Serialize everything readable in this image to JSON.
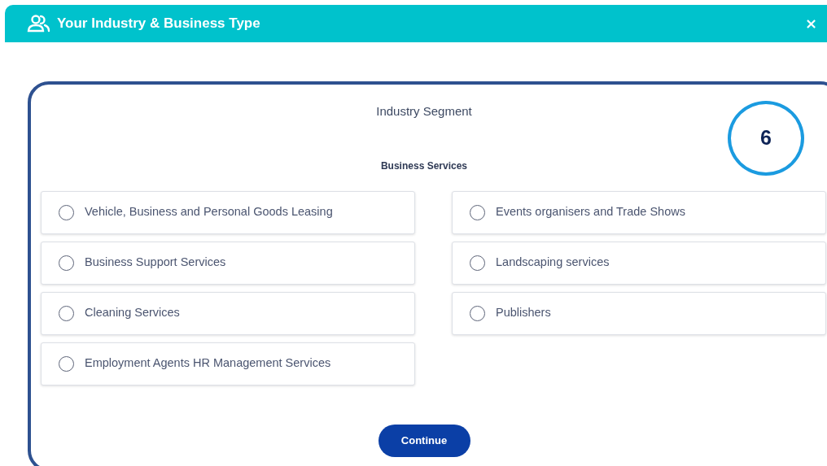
{
  "window": {
    "title": "Your Industry & Business Type",
    "close": "×"
  },
  "section": {
    "title": "Industry Segment",
    "callout": "6",
    "subtitle": "Business Services"
  },
  "options": [
    {
      "label": "Vehicle, Business and Personal Goods Leasing",
      "selected": false
    },
    {
      "label": "Events organisers and Trade Shows",
      "selected": false
    },
    {
      "label": "Business Support Services",
      "selected": false
    },
    {
      "label": "Landscaping services",
      "selected": false
    },
    {
      "label": "Cleaning Services",
      "selected": false
    },
    {
      "label": "Publishers",
      "selected": false
    },
    {
      "label": "Employment Agents HR Management Services",
      "selected": false
    }
  ],
  "buttons": [
    "Continue"
  ]
}
